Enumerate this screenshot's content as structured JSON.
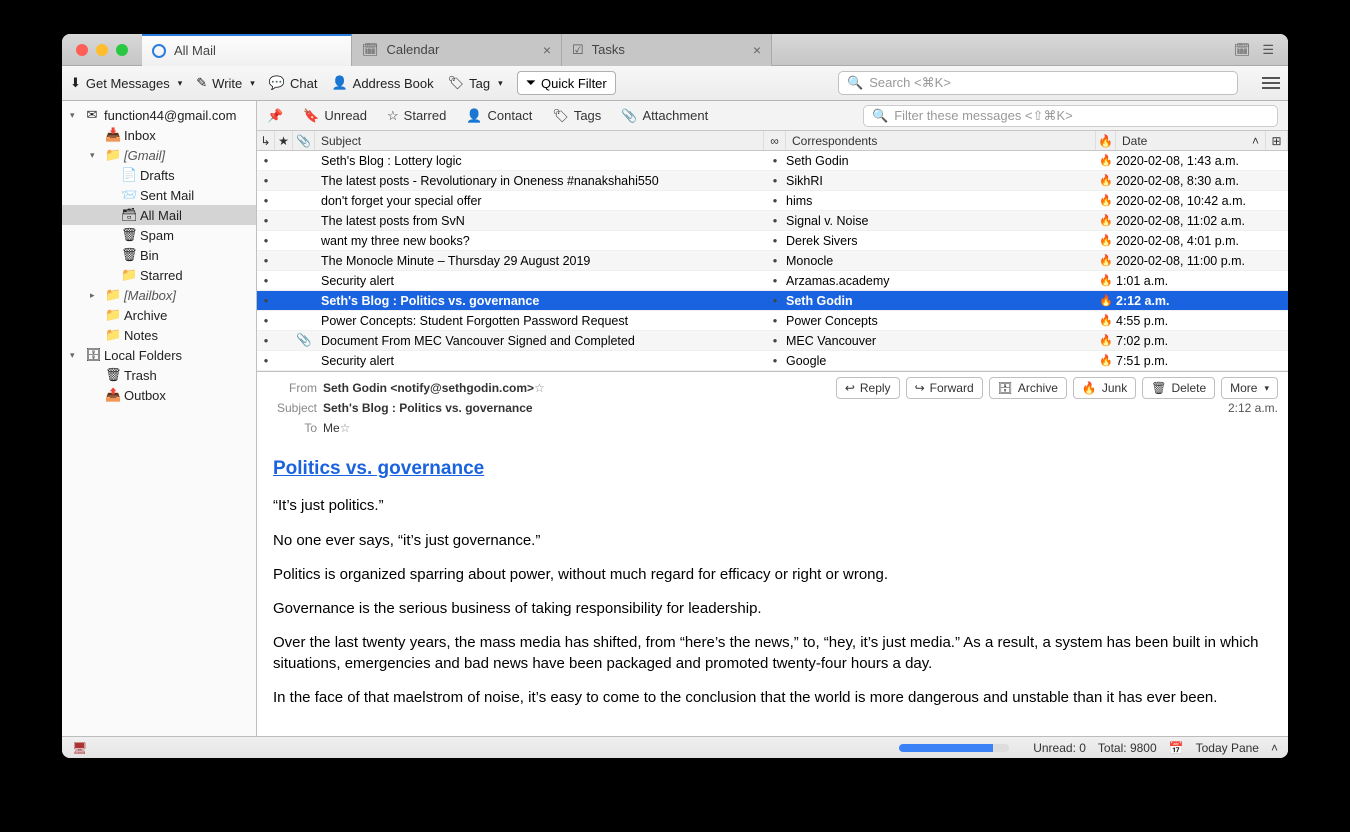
{
  "tabs": [
    {
      "label": "All Mail",
      "active": true
    },
    {
      "label": "Calendar",
      "active": false
    },
    {
      "label": "Tasks",
      "active": false
    }
  ],
  "toolbar": {
    "get_messages": "Get Messages",
    "write": "Write",
    "chat": "Chat",
    "address_book": "Address Book",
    "tag": "Tag",
    "quick_filter": "Quick Filter",
    "search_placeholder": "Search <⌘K>"
  },
  "sidebar": {
    "account": "function44@gmail.com",
    "items": [
      {
        "label": "Inbox",
        "level": 2,
        "icon": "📥"
      },
      {
        "label": "[Gmail]",
        "level": 2,
        "icon": "📁",
        "italic": true,
        "twisty": "▾"
      },
      {
        "label": "Drafts",
        "level": 3,
        "icon": "📄"
      },
      {
        "label": "Sent Mail",
        "level": 3,
        "icon": "📨"
      },
      {
        "label": "All Mail",
        "level": 3,
        "icon": "🗃",
        "selected": true
      },
      {
        "label": "Spam",
        "level": 3,
        "icon": "🗑"
      },
      {
        "label": "Bin",
        "level": 3,
        "icon": "🗑"
      },
      {
        "label": "Starred",
        "level": 3,
        "icon": "📁"
      },
      {
        "label": "[Mailbox]",
        "level": 2,
        "icon": "📁",
        "italic": true,
        "twisty": "▸"
      },
      {
        "label": "Archive",
        "level": 2,
        "icon": "📁"
      },
      {
        "label": "Notes",
        "level": 2,
        "icon": "📁"
      }
    ],
    "local_folders": "Local Folders",
    "local_items": [
      {
        "label": "Trash",
        "icon": "🗑"
      },
      {
        "label": "Outbox",
        "icon": "📤"
      }
    ]
  },
  "filterbar": {
    "unread": "Unread",
    "starred": "Starred",
    "contact": "Contact",
    "tags": "Tags",
    "attachment": "Attachment",
    "filter_placeholder": "Filter these messages <⇧⌘K>"
  },
  "columns": {
    "subject": "Subject",
    "correspondents": "Correspondents",
    "date": "Date"
  },
  "messages": [
    {
      "subject": "Seth's Blog : Lottery logic",
      "corr": "Seth Godin",
      "date": "2020-02-08, 1:43 a.m."
    },
    {
      "subject": "The latest posts - Revolutionary in Oneness #nanakshahi550",
      "corr": "SikhRI",
      "date": "2020-02-08, 8:30 a.m."
    },
    {
      "subject": "don't forget your special offer",
      "corr": "hims",
      "date": "2020-02-08, 10:42 a.m."
    },
    {
      "subject": "The latest posts from SvN",
      "corr": "Signal v. Noise",
      "date": "2020-02-08, 11:02 a.m."
    },
    {
      "subject": "want my three new books?",
      "corr": "Derek Sivers",
      "date": "2020-02-08, 4:01 p.m."
    },
    {
      "subject": "The Monocle Minute – Thursday 29 August 2019",
      "corr": "Monocle",
      "date": "2020-02-08, 11:00 p.m."
    },
    {
      "subject": "Security alert",
      "corr": "Arzamas.academy",
      "date": "1:01 a.m."
    },
    {
      "subject": "Seth's Blog : Politics vs. governance",
      "corr": "Seth Godin",
      "date": "2:12 a.m.",
      "selected": true
    },
    {
      "subject": "Power Concepts: Student Forgotten Password Request",
      "corr": "Power Concepts",
      "date": "4:55 p.m."
    },
    {
      "subject": "Document From MEC Vancouver Signed and Completed",
      "corr": "MEC Vancouver",
      "date": "7:02 p.m.",
      "attach": true
    },
    {
      "subject": "Security alert",
      "corr": "Google",
      "date": "7:51 p.m."
    }
  ],
  "preview": {
    "from_label": "From",
    "from": "Seth Godin <notify@sethgodin.com>",
    "subject_label": "Subject",
    "subject": "Seth's Blog : Politics vs. governance",
    "to_label": "To",
    "to": "Me",
    "time": "2:12 a.m.",
    "actions": {
      "reply": "Reply",
      "forward": "Forward",
      "archive": "Archive",
      "junk": "Junk",
      "delete": "Delete",
      "more": "More"
    },
    "title": "Politics vs. governance",
    "paragraphs": [
      "“It’s just politics.”",
      "No one ever says, “it’s just governance.”",
      "Politics is organized sparring about power, without much regard for efficacy or right or wrong.",
      "Governance is the serious business of taking responsibility for leadership.",
      "Over the last twenty years, the mass media has shifted, from “here’s the news,” to, “hey, it’s just media.” As a result, a system has been built in which situations, emergencies and bad news have been packaged and promoted twenty-four hours a day.",
      "In the face of that maelstrom of noise, it’s easy to come to the conclusion that the world is more dangerous and unstable than it has ever been."
    ]
  },
  "status": {
    "unread": "Unread: 0",
    "total": "Total: 9800",
    "today_pane": "Today Pane",
    "progress_pct": 85
  }
}
